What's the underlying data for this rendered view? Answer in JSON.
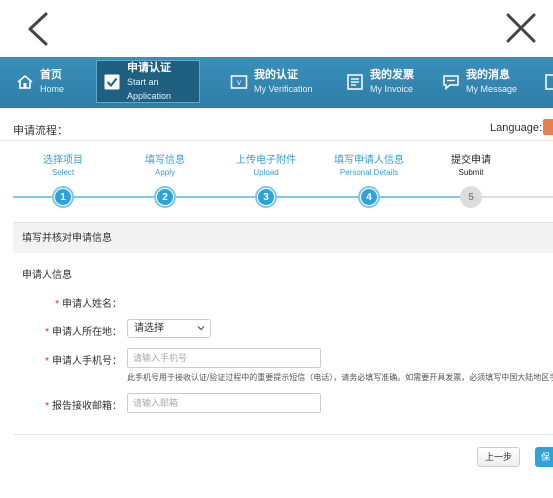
{
  "nav": {
    "items": [
      {
        "cn": "首页",
        "en": "Home",
        "icon": "home-icon"
      },
      {
        "cn": "申请认证",
        "en": "Start an Application",
        "icon": "checkbox-icon"
      },
      {
        "cn": "我的认证",
        "en": "My Verification",
        "icon": "verification-icon"
      },
      {
        "cn": "我的发票",
        "en": "My Invoice",
        "icon": "invoice-icon"
      },
      {
        "cn": "我的消息",
        "en": "My Message",
        "icon": "message-icon"
      }
    ],
    "active_index": 1
  },
  "process": {
    "title": "申请流程：",
    "language_label": "Language:"
  },
  "steps": [
    {
      "cn": "选择项目",
      "en": "Select",
      "num": "1",
      "status": "done"
    },
    {
      "cn": "填写信息",
      "en": "Apply",
      "num": "2",
      "status": "done"
    },
    {
      "cn": "上传电子附件",
      "en": "Upload",
      "num": "3",
      "status": "done"
    },
    {
      "cn": "填写申请人信息",
      "en": "Personal Details",
      "num": "4",
      "status": "done"
    },
    {
      "cn": "提交申请",
      "en": "Submit",
      "num": "5",
      "status": "pending"
    }
  ],
  "form": {
    "section_title": "填写并核对申请信息",
    "subsection_title": "申请人信息",
    "fields": {
      "name_label": "申请人姓名：",
      "location_label": "申请人所在地：",
      "location_value": "请选择",
      "phone_label": "申请人手机号：",
      "phone_placeholder": "请输入手机号",
      "phone_hint": "此手机号用于接收认证/验证过程中的重要提示短信（电话），请务必填写准确。如需要开具发票，必须填写中国大陆地区手机号",
      "email_label": "报告接收邮箱：",
      "email_placeholder": "请输入邮箱"
    }
  },
  "buttons": {
    "prev": "上一步",
    "save": "保"
  },
  "colors": {
    "nav_bg": "#2e7ea7",
    "accent": "#2ea3d9",
    "required": "#dd2222",
    "lang_button": "#e87e4b"
  }
}
